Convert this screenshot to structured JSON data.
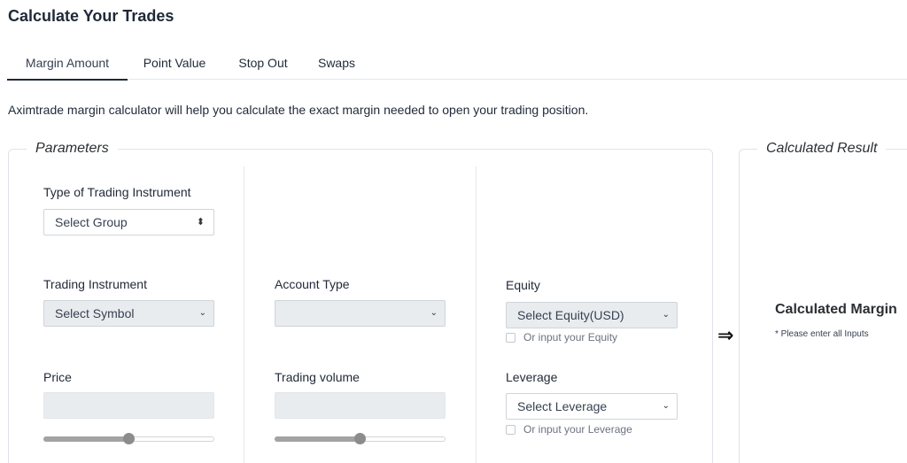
{
  "page": {
    "title": "Calculate Your Trades"
  },
  "tabs": [
    {
      "label": "Margin Amount",
      "active": true
    },
    {
      "label": "Point Value",
      "active": false
    },
    {
      "label": "Stop Out",
      "active": false
    },
    {
      "label": "Swaps",
      "active": false
    }
  ],
  "description": "Aximtrade margin calculator will help you calculate the exact margin needed to open your trading position.",
  "parameters": {
    "legend": "Parameters",
    "instrument_type": {
      "label": "Type of Trading Instrument",
      "placeholder": "Select Group"
    },
    "instrument": {
      "label": "Trading Instrument",
      "placeholder": "Select Symbol"
    },
    "account_type": {
      "label": "Account Type",
      "value": ""
    },
    "equity": {
      "label": "Equity",
      "placeholder": "Select Equity(USD)",
      "checkbox_label": "Or input your Equity"
    },
    "price": {
      "label": "Price",
      "value": "",
      "slider_level": 0.5
    },
    "volume": {
      "label": "Trading volume",
      "value": "",
      "slider_level": 0.5
    },
    "leverage": {
      "label": "Leverage",
      "placeholder": "Select Leverage",
      "checkbox_label": "Or input your Leverage"
    }
  },
  "result": {
    "legend": "Calculated Result",
    "title": "Calculated Margin",
    "note": "* Please enter all Inputs"
  },
  "icons": {
    "arrow": "double-right-arrow-icon",
    "select": "chevron-down-icon",
    "updown": "up-down-caret-icon"
  }
}
